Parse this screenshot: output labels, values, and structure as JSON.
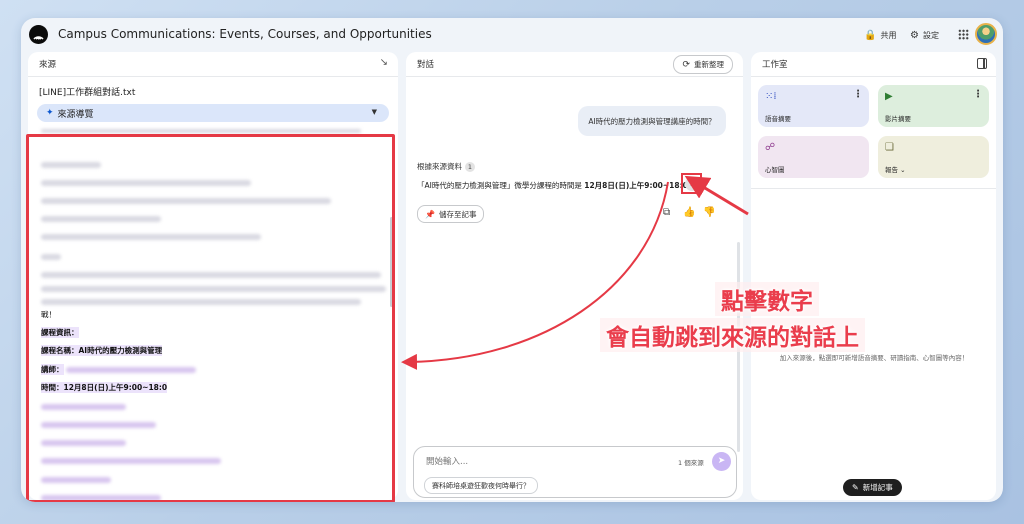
{
  "header": {
    "title": "Campus Communications: Events, Courses, and Opportunities",
    "share_label": "共用",
    "settings_label": "設定"
  },
  "source_panel": {
    "title": "來源",
    "file_name": "[LINE]工作群組對話.txt",
    "guide_label": "來源導覽",
    "visible_lines": [
      {
        "text": "戰！",
        "bold": false
      },
      {
        "text": "課程資訊：",
        "bold": true
      },
      {
        "text": "課程名稱：AI時代的壓力檢測與管理",
        "bold": true
      },
      {
        "text": "講師：",
        "bold": true
      },
      {
        "text": "時間：12月8日(日)上午9:00~18:0",
        "bold": true
      }
    ]
  },
  "chat_panel": {
    "title": "對話",
    "refresh_label": "重新整理",
    "user_message": "AI時代的壓力檢測與管理講座的時間？",
    "based_on_label": "根據來源資料",
    "based_on_count": "1",
    "answer_prefix": "「AI時代的壓力檢測與管理」微學分課程的時間是",
    "answer_bold": "12月8日(日)上午9:00~18:0",
    "citation_number": "1",
    "save_note_label": "儲存至記事",
    "input_placeholder": "開始輸入...",
    "source_count_label": "1 個來源",
    "suggestion": "賽科師培桌遊狂歡夜何時舉行？"
  },
  "studio_panel": {
    "title": "工作室",
    "cards": [
      {
        "label": "語音摘要",
        "icon": "audio-waveform-icon"
      },
      {
        "label": "影片摘要",
        "icon": "video-icon"
      },
      {
        "label": "心智圖",
        "icon": "mind-map-icon"
      },
      {
        "label": "報告",
        "icon": "report-icon"
      }
    ],
    "empty_hint": "加入來源後，點選即可新增語音摘要、研讀指南、心智圖等內容！",
    "add_note_label": "新增記事"
  },
  "callout": {
    "line1": "點擊數字",
    "line2": "會自動跳到來源的對話上",
    "color": "#ea3d4c"
  }
}
